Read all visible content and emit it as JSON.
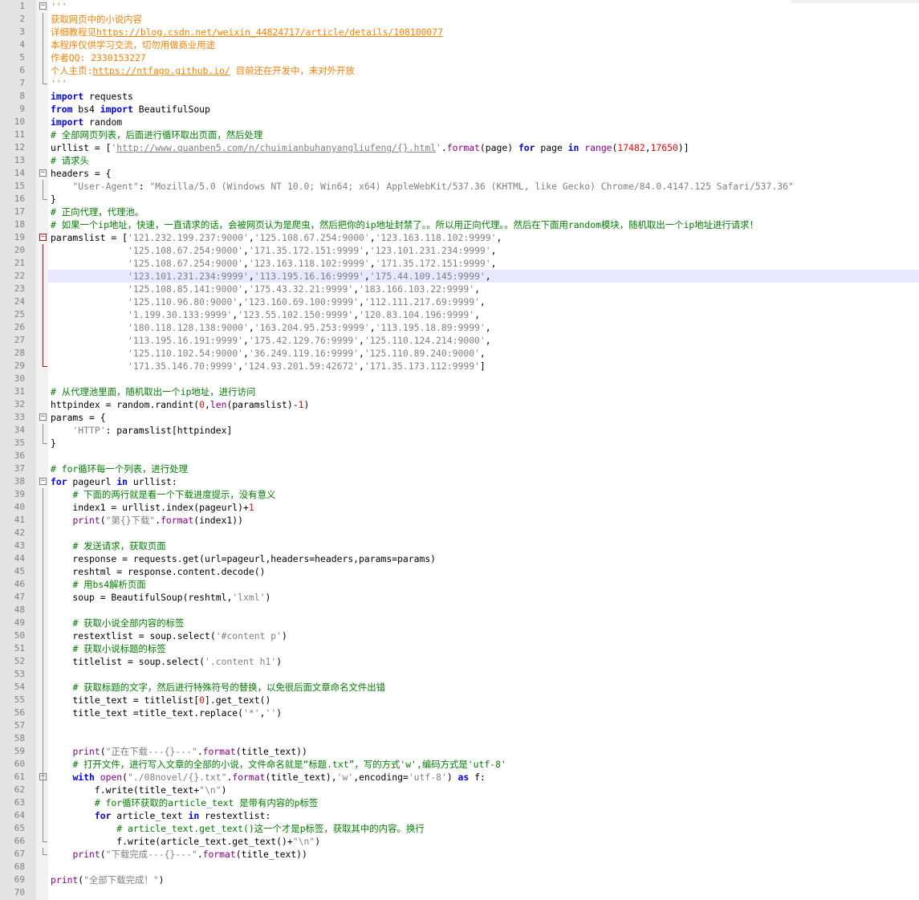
{
  "editor": {
    "language": "python",
    "current_line": 22,
    "colors": {
      "keyword": "#0000ff",
      "builtin": "#880088",
      "string": "#808080",
      "comment": "#008000",
      "docstring": "#ff8000",
      "number": "#ff0000",
      "gutter": "#e4e4e4",
      "current_line": "#e8e8ff"
    },
    "lines": [
      [
        [
          "doc",
          "'''"
        ]
      ],
      [
        [
          "doc",
          "获取网页中的小说内容"
        ]
      ],
      [
        [
          "doc",
          "详细教程见"
        ],
        [
          "doc url",
          "https://blog.csdn.net/weixin_44824717/article/details/108100077"
        ]
      ],
      [
        [
          "doc",
          "本程序仅供学习交流，切勿用做商业用途"
        ]
      ],
      [
        [
          "doc",
          "作者QQ: 2330153227"
        ]
      ],
      [
        [
          "doc",
          "个人主页:"
        ],
        [
          "doc url",
          "https://ntfago.github.io/"
        ],
        [
          "doc",
          " 目前还在开发中，未对外开放"
        ]
      ],
      [
        [
          "doc",
          "'''"
        ]
      ],
      [
        [
          "kw",
          "import"
        ],
        [
          "t",
          " requests"
        ]
      ],
      [
        [
          "kw",
          "from"
        ],
        [
          "t",
          " bs4 "
        ],
        [
          "kw",
          "import"
        ],
        [
          "t",
          " BeautifulSoup"
        ]
      ],
      [
        [
          "kw",
          "import"
        ],
        [
          "t",
          " random"
        ]
      ],
      [
        [
          "com",
          "# 全部网页列表，后面进行循环取出页面，然后处理"
        ]
      ],
      [
        [
          "t",
          "urllist = ["
        ],
        [
          "str",
          "'"
        ],
        [
          "str url",
          "http://www.quanben5.com/n/chuimianbuhanyangliufeng/{}.html"
        ],
        [
          "str",
          "'"
        ],
        [
          "t",
          "."
        ],
        [
          "bi",
          "format"
        ],
        [
          "t",
          "(page) "
        ],
        [
          "kw",
          "for"
        ],
        [
          "t",
          " page "
        ],
        [
          "kw",
          "in"
        ],
        [
          "t",
          " "
        ],
        [
          "bi",
          "range"
        ],
        [
          "t",
          "("
        ],
        [
          "num",
          "17482"
        ],
        [
          "t",
          ","
        ],
        [
          "num",
          "17650"
        ],
        [
          "t",
          ")]"
        ]
      ],
      [
        [
          "com",
          "# 请求头"
        ]
      ],
      [
        [
          "t",
          "headers = {"
        ]
      ],
      [
        [
          "t",
          "    "
        ],
        [
          "str",
          "\"User-Agent\""
        ],
        [
          "t",
          ": "
        ],
        [
          "str",
          "\"Mozilla/5.0 (Windows NT 10.0; Win64; x64) AppleWebKit/537.36 (KHTML, like Gecko) Chrome/84.0.4147.125 Safari/537.36\""
        ]
      ],
      [
        [
          "t",
          "}"
        ]
      ],
      [
        [
          "com",
          "# 正向代理，代理池。"
        ]
      ],
      [
        [
          "com",
          "# 如果一个ip地址，快速，一直请求的话，会被网页认为是爬虫，然后把你的ip地址封禁了。。所以用正向代理。。然后在下面用random模块，随机取出一个ip地址进行请求！"
        ]
      ],
      [
        [
          "t",
          "paramslist = ["
        ],
        [
          "str",
          "'121.232.199.237:9000'"
        ],
        [
          "t",
          ","
        ],
        [
          "str",
          "'125.108.67.254:9000'"
        ],
        [
          "t",
          ","
        ],
        [
          "str",
          "'123.163.118.102:9999'"
        ],
        [
          "t",
          ","
        ]
      ],
      [
        [
          "t",
          "              "
        ],
        [
          "str",
          "'125.108.67.254:9000'"
        ],
        [
          "t",
          ","
        ],
        [
          "str",
          "'171.35.172.151:9999'"
        ],
        [
          "t",
          ","
        ],
        [
          "str",
          "'123.101.231.234:9999'"
        ],
        [
          "t",
          ","
        ]
      ],
      [
        [
          "t",
          "              "
        ],
        [
          "str",
          "'125.108.67.254:9000'"
        ],
        [
          "t",
          ","
        ],
        [
          "str",
          "'123.163.118.102:9999'"
        ],
        [
          "t",
          ","
        ],
        [
          "str",
          "'171.35.172.151:9999'"
        ],
        [
          "t",
          ","
        ]
      ],
      [
        [
          "t",
          "              "
        ],
        [
          "str",
          "'123.101.231.234:9999'"
        ],
        [
          "t",
          ","
        ],
        [
          "str",
          "'113.195.16.16:9999'"
        ],
        [
          "t",
          ","
        ],
        [
          "str",
          "'175.44.109.145:9999'"
        ],
        [
          "t",
          ","
        ]
      ],
      [
        [
          "t",
          "              "
        ],
        [
          "str",
          "'125.108.85.141:9000'"
        ],
        [
          "t",
          ","
        ],
        [
          "str",
          "'175.43.32.21:9999'"
        ],
        [
          "t",
          ","
        ],
        [
          "str",
          "'183.166.103.22:9999'"
        ],
        [
          "t",
          ","
        ]
      ],
      [
        [
          "t",
          "              "
        ],
        [
          "str",
          "'125.110.96.80:9000'"
        ],
        [
          "t",
          ","
        ],
        [
          "str",
          "'123.160.69.100:9999'"
        ],
        [
          "t",
          ","
        ],
        [
          "str",
          "'112.111.217.69:9999'"
        ],
        [
          "t",
          ","
        ]
      ],
      [
        [
          "t",
          "              "
        ],
        [
          "str",
          "'1.199.30.133:9999'"
        ],
        [
          "t",
          ","
        ],
        [
          "str",
          "'123.55.102.150:9999'"
        ],
        [
          "t",
          ","
        ],
        [
          "str",
          "'120.83.104.196:9999'"
        ],
        [
          "t",
          ","
        ]
      ],
      [
        [
          "t",
          "              "
        ],
        [
          "str",
          "'180.118.128.138:9000'"
        ],
        [
          "t",
          ","
        ],
        [
          "str",
          "'163.204.95.253:9999'"
        ],
        [
          "t",
          ","
        ],
        [
          "str",
          "'113.195.18.89:9999'"
        ],
        [
          "t",
          ","
        ]
      ],
      [
        [
          "t",
          "              "
        ],
        [
          "str",
          "'113.195.16.191:9999'"
        ],
        [
          "t",
          ","
        ],
        [
          "str",
          "'175.42.129.76:9999'"
        ],
        [
          "t",
          ","
        ],
        [
          "str",
          "'125.110.124.214:9000'"
        ],
        [
          "t",
          ","
        ]
      ],
      [
        [
          "t",
          "              "
        ],
        [
          "str",
          "'125.110.102.54:9000'"
        ],
        [
          "t",
          ","
        ],
        [
          "str",
          "'36.249.119.16:9999'"
        ],
        [
          "t",
          ","
        ],
        [
          "str",
          "'125.110.89.240:9000'"
        ],
        [
          "t",
          ","
        ]
      ],
      [
        [
          "t",
          "              "
        ],
        [
          "str",
          "'171.35.146.70:9999'"
        ],
        [
          "t",
          ","
        ],
        [
          "str",
          "'124.93.201.59:42672'"
        ],
        [
          "t",
          ","
        ],
        [
          "str",
          "'171.35.173.112:9999'"
        ],
        [
          "t",
          "]"
        ]
      ],
      [],
      [
        [
          "com",
          "# 从代理池里面，随机取出一个ip地址，进行访问"
        ]
      ],
      [
        [
          "t",
          "httpindex = random.randint("
        ],
        [
          "num",
          "0"
        ],
        [
          "t",
          ","
        ],
        [
          "bi",
          "len"
        ],
        [
          "t",
          "(paramslist)-"
        ],
        [
          "num",
          "1"
        ],
        [
          "t",
          ")"
        ]
      ],
      [
        [
          "t",
          "params = {"
        ]
      ],
      [
        [
          "t",
          "    "
        ],
        [
          "str",
          "'HTTP'"
        ],
        [
          "t",
          ": paramslist[httpindex]"
        ]
      ],
      [
        [
          "t",
          "}"
        ]
      ],
      [],
      [
        [
          "com",
          "# for循环每一个列表，进行处理"
        ]
      ],
      [
        [
          "kw",
          "for"
        ],
        [
          "t",
          " pageurl "
        ],
        [
          "kw",
          "in"
        ],
        [
          "t",
          " urllist:"
        ]
      ],
      [
        [
          "t",
          "    "
        ],
        [
          "com",
          "# 下面的两行就是看一个下载进度提示，没有意义"
        ]
      ],
      [
        [
          "t",
          "    index1 = urllist.index(pageurl)+"
        ],
        [
          "num",
          "1"
        ]
      ],
      [
        [
          "t",
          "    "
        ],
        [
          "bi",
          "print"
        ],
        [
          "t",
          "("
        ],
        [
          "str",
          "\"第{}下载\""
        ],
        [
          "t",
          "."
        ],
        [
          "bi",
          "format"
        ],
        [
          "t",
          "(index1))"
        ]
      ],
      [],
      [
        [
          "t",
          "    "
        ],
        [
          "com",
          "# 发送请求，获取页面"
        ]
      ],
      [
        [
          "t",
          "    response = requests.get(url=pageurl,headers=headers,params=params)"
        ]
      ],
      [
        [
          "t",
          "    reshtml = response.content.decode()"
        ]
      ],
      [
        [
          "t",
          "    "
        ],
        [
          "com",
          "# 用bs4解析页面"
        ]
      ],
      [
        [
          "t",
          "    soup = BeautifulSoup(reshtml,"
        ],
        [
          "str",
          "'lxml'"
        ],
        [
          "t",
          ")"
        ]
      ],
      [],
      [
        [
          "t",
          "    "
        ],
        [
          "com",
          "# 获取小说全部内容的标签"
        ]
      ],
      [
        [
          "t",
          "    restextlist = soup.select("
        ],
        [
          "str",
          "'#content p'"
        ],
        [
          "t",
          ")"
        ]
      ],
      [
        [
          "t",
          "    "
        ],
        [
          "com",
          "# 获取小说标题的标签"
        ]
      ],
      [
        [
          "t",
          "    titlelist = soup.select("
        ],
        [
          "str",
          "'.content h1'"
        ],
        [
          "t",
          ")"
        ]
      ],
      [],
      [
        [
          "t",
          "    "
        ],
        [
          "com",
          "# 获取标题的文字，然后进行特殊符号的替换，以免很后面文章命名文件出错"
        ]
      ],
      [
        [
          "t",
          "    title_text = titlelist["
        ],
        [
          "num",
          "0"
        ],
        [
          "t",
          "].get_text()"
        ]
      ],
      [
        [
          "t",
          "    title_text =title_text.replace("
        ],
        [
          "str",
          "'*'"
        ],
        [
          "t",
          ","
        ],
        [
          "str",
          "''"
        ],
        [
          "t",
          ")"
        ]
      ],
      [],
      [],
      [
        [
          "t",
          "    "
        ],
        [
          "bi",
          "print"
        ],
        [
          "t",
          "("
        ],
        [
          "str",
          "\"正在下载---{}---\""
        ],
        [
          "t",
          "."
        ],
        [
          "bi",
          "format"
        ],
        [
          "t",
          "(title_text))"
        ]
      ],
      [
        [
          "t",
          "    "
        ],
        [
          "com",
          "# 打开文件，进行写入文章的全部的小说，文件命名就是“标题.txt”，写的方式'w',编码方式是'utf-8'"
        ]
      ],
      [
        [
          "t",
          "    "
        ],
        [
          "kw",
          "with"
        ],
        [
          "t",
          " "
        ],
        [
          "bi",
          "open"
        ],
        [
          "t",
          "("
        ],
        [
          "str",
          "\"./08novel/{}.txt\""
        ],
        [
          "t",
          "."
        ],
        [
          "bi",
          "format"
        ],
        [
          "t",
          "(title_text),"
        ],
        [
          "str",
          "'w'"
        ],
        [
          "t",
          ",encoding="
        ],
        [
          "str",
          "'utf-8'"
        ],
        [
          "t",
          ") "
        ],
        [
          "kw",
          "as"
        ],
        [
          "t",
          " f:"
        ]
      ],
      [
        [
          "t",
          "        f.write(title_text+"
        ],
        [
          "str",
          "\"\\n\""
        ],
        [
          "t",
          ")"
        ]
      ],
      [
        [
          "t",
          "        "
        ],
        [
          "com",
          "# for循环获取的article_text 是带有内容的p标签"
        ]
      ],
      [
        [
          "t",
          "        "
        ],
        [
          "kw",
          "for"
        ],
        [
          "t",
          " article_text "
        ],
        [
          "kw",
          "in"
        ],
        [
          "t",
          " restextlist:"
        ]
      ],
      [
        [
          "t",
          "            "
        ],
        [
          "com",
          "# article_text.get_text()这一个才是p标签，获取其中的内容。换行"
        ]
      ],
      [
        [
          "t",
          "            f.write(article_text.get_text()+"
        ],
        [
          "str",
          "\"\\n\""
        ],
        [
          "t",
          ")"
        ]
      ],
      [
        [
          "t",
          "    "
        ],
        [
          "bi",
          "print"
        ],
        [
          "t",
          "("
        ],
        [
          "str",
          "\"下载完成---{}---\""
        ],
        [
          "t",
          "."
        ],
        [
          "bi",
          "format"
        ],
        [
          "t",
          "(title_text))"
        ]
      ],
      [],
      [
        [
          "bi",
          "print"
        ],
        [
          "t",
          "("
        ],
        [
          "str",
          "\"全部下载完成！\""
        ],
        [
          "t",
          ")"
        ]
      ],
      []
    ]
  }
}
